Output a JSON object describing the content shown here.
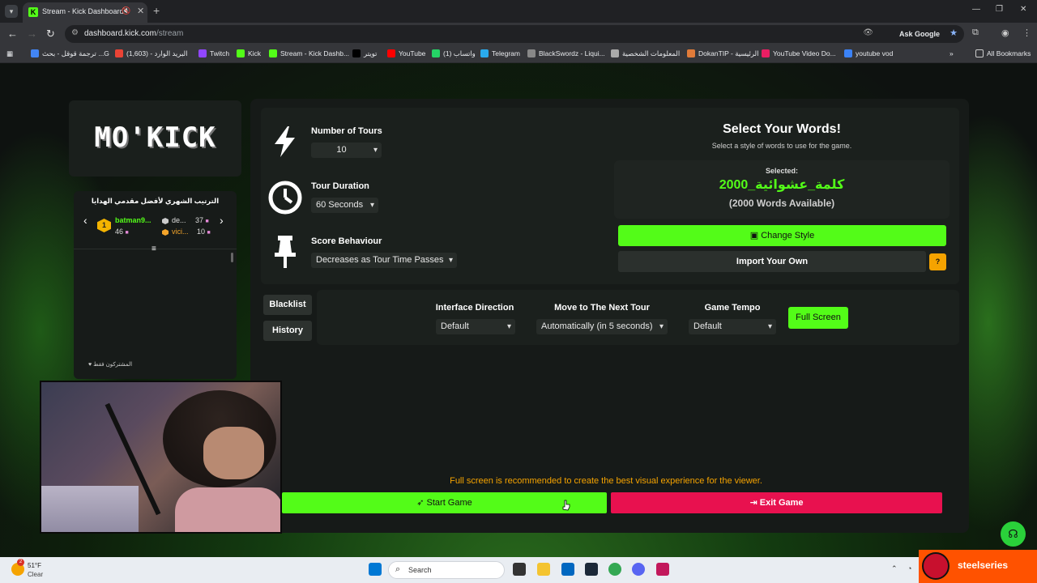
{
  "browser": {
    "tab_title": "Stream - Kick Dashboard",
    "url_domain": "dashboard.kick.com",
    "url_path": "/stream",
    "ask_google": "Ask Google",
    "all_bookmarks": "All Bookmarks",
    "bookmarks": [
      {
        "label": "ترجمة قوقل - بحث ...G",
        "color": "#4285f4"
      },
      {
        "label": "البريد الوارد - (1,603)",
        "color": "#ea4335"
      },
      {
        "label": "Twitch",
        "color": "#9146ff"
      },
      {
        "label": "Kick",
        "color": "#53fc18"
      },
      {
        "label": "Stream - Kick Dashb...",
        "color": "#53fc18"
      },
      {
        "label": "تويتر",
        "color": "#000000"
      },
      {
        "label": "YouTube",
        "color": "#ff0000"
      },
      {
        "label": "واتساب (1)",
        "color": "#25d366"
      },
      {
        "label": "Telegram",
        "color": "#2aabee"
      },
      {
        "label": "BlackSwordz - Liqui...",
        "color": "#888888"
      },
      {
        "label": "المعلومات الشخصية",
        "color": "#aaaaaa"
      },
      {
        "label": "DokanTIP - الرئيسية",
        "color": "#e07b39"
      },
      {
        "label": "YouTube Video Do...",
        "color": "#e91e63"
      },
      {
        "label": "youtube vod",
        "color": "#3b82f6"
      }
    ]
  },
  "app": {
    "logo": "MO'KICK",
    "leaderboard": {
      "title": "الترتيب الشهري لأفضل مقدمي الهدايا",
      "entries": [
        {
          "rank": "1",
          "name": "batman9...",
          "points": "46"
        },
        {
          "name": "de...",
          "points": "37"
        },
        {
          "name": "vici...",
          "points": "10"
        }
      ],
      "subs_only": "المشتركون فقط"
    },
    "settings": {
      "tours_label": "Number of Tours",
      "tours_value": "10",
      "duration_label": "Tour Duration",
      "duration_value": "60 Seconds",
      "score_label": "Score Behaviour",
      "score_value": "Decreases as Tour Time Passes"
    },
    "words": {
      "title": "Select Your Words!",
      "subtitle": "Select a style of words to use for the game.",
      "selected_label": "Selected:",
      "selected_value": "كلمة_عشوائية_2000",
      "available": "(2000 Words Available)",
      "change_style": "Change Style",
      "import_own": "Import Your Own",
      "help": "?"
    },
    "side_buttons": {
      "blacklist": "Blacklist",
      "history": "History"
    },
    "options": {
      "interface_label": "Interface Direction",
      "interface_value": "Default",
      "next_tour_label": "Move to The Next Tour",
      "next_tour_value": "Automatically (in 5 seconds)",
      "tempo_label": "Game Tempo",
      "tempo_value": "Default",
      "full_screen": "Full Screen"
    },
    "hint": "Full screen is recommended to create the best visual experience for the viewer.",
    "start_game": "Start Game",
    "exit_game": "Exit Game"
  },
  "taskbar": {
    "weather_temp": "51°F",
    "weather_cond": "Clear",
    "weather_badge": "2",
    "search_placeholder": "Search",
    "brand": "steelseries"
  },
  "colors": {
    "accent": "#53fc18",
    "danger": "#e8114f",
    "warning": "#f5a300"
  }
}
